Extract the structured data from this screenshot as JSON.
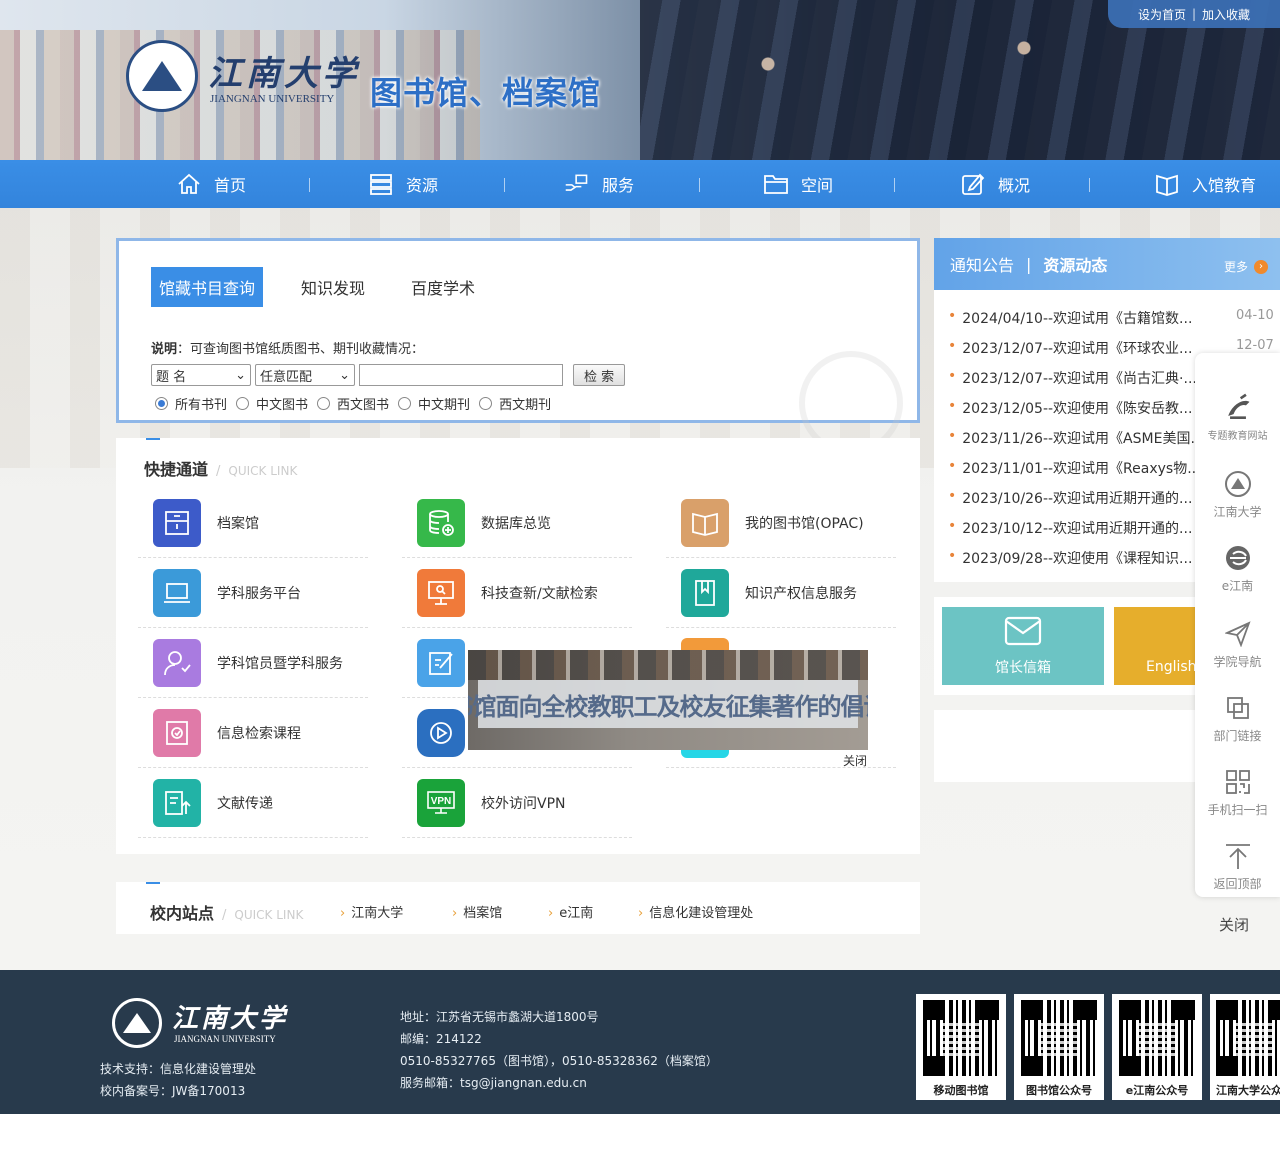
{
  "header": {
    "logo_cn": "江南大学",
    "logo_en": "JIANGNAN UNIVERSITY",
    "site_title": "图书馆、档案馆",
    "top_links": [
      "设为首页",
      "加入收藏"
    ]
  },
  "nav": [
    {
      "label": "首页",
      "icon": "home-icon"
    },
    {
      "label": "资源",
      "icon": "database-icon"
    },
    {
      "label": "服务",
      "icon": "hand-service-icon"
    },
    {
      "label": "空间",
      "icon": "folder-icon"
    },
    {
      "label": "概况",
      "icon": "edit-icon"
    },
    {
      "label": "入馆教育",
      "icon": "book-open-icon"
    }
  ],
  "search": {
    "tabs": [
      "馆藏书目查询",
      "知识发现",
      "百度学术"
    ],
    "desc_bold": "说明",
    "desc_text": "：可查询图书馆纸质图书、期刊收藏情况：",
    "field_select": "题 名",
    "match_select": "任意匹配",
    "input_value": "",
    "button": "检 索",
    "radios": [
      "所有书刊",
      "中文图书",
      "西文图书",
      "中文期刊",
      "西文期刊"
    ],
    "radio_selected": 0
  },
  "quick": {
    "title": "快捷通道",
    "title_en": "QUICK LINK",
    "items": [
      {
        "label": "档案馆",
        "icon": "archive-icon",
        "color": "#3d5bc9"
      },
      {
        "label": "数据库总览",
        "icon": "database-add-icon",
        "color": "#36b84a"
      },
      {
        "label": "我的图书馆(OPAC)",
        "icon": "open-book-icon",
        "color": "#d9a06a"
      },
      {
        "label": "学科服务平台",
        "icon": "laptop-icon",
        "color": "#3b9ad9"
      },
      {
        "label": "科技查新/文献检索",
        "icon": "monitor-search-icon",
        "color": "#f07a3a"
      },
      {
        "label": "知识产权信息服务",
        "icon": "bookmark-book-icon",
        "color": "#1fa89a"
      },
      {
        "label": "学科馆员暨学科服务",
        "icon": "user-icon",
        "color": "#a97be0"
      },
      {
        "label": "",
        "icon": "edit-doc-icon",
        "color": "#4aa3e8"
      },
      {
        "label": "信息检索课程",
        "icon": "search-doc-icon",
        "color": "#e07aa8"
      },
      {
        "label": "",
        "icon": "play-icon",
        "color": "#2b6fc0"
      },
      {
        "label": "文献传递",
        "icon": "doc-upload-icon",
        "color": "#22b3a6"
      },
      {
        "label": "校外访问VPN",
        "icon": "vpn-icon",
        "color": "#1aa33a"
      }
    ]
  },
  "popup": {
    "text": "图书馆面向全校教职工及校友征集著作的倡议书",
    "close": "关闭"
  },
  "sites": {
    "title": "校内站点",
    "title_en": "QUICK LINK",
    "links": [
      "江南大学",
      "档案馆",
      "e江南",
      "信息化建设管理处"
    ]
  },
  "notice": {
    "tab1": "通知公告",
    "tab2": "资源动态",
    "more": "更多",
    "items": [
      {
        "title": "2024/04/10--欢迎试用《古籍馆数...",
        "date": "04-10"
      },
      {
        "title": "2023/12/07--欢迎试用《环球农业...",
        "date": "12-07"
      },
      {
        "title": "2023/12/07--欢迎试用《尚古汇典·...",
        "date": ""
      },
      {
        "title": "2023/12/05--欢迎使用《陈安岳教...",
        "date": ""
      },
      {
        "title": "2023/11/26--欢迎试用《ASME美国...",
        "date": ""
      },
      {
        "title": "2023/11/01--欢迎试用《Reaxys物...",
        "date": ""
      },
      {
        "title": "2023/10/26--欢迎试用近期开通的...",
        "date": ""
      },
      {
        "title": "2023/10/12--欢迎试用近期开通的...",
        "date": ""
      },
      {
        "title": "2023/09/28--欢迎使用《课程知识...",
        "date": ""
      }
    ]
  },
  "cards": [
    {
      "label": "馆长信箱",
      "icon": "mail-icon",
      "color": "#6cc4c4"
    },
    {
      "label": "English",
      "icon": "globe-icon",
      "color": "#e6ae2c"
    }
  ],
  "float_bar": {
    "items": [
      {
        "label": "专题教育网站",
        "icon": "party-emblem-icon"
      },
      {
        "label": "江南大学",
        "icon": "university-seal-icon"
      },
      {
        "label": "e江南",
        "icon": "e-logo-icon"
      },
      {
        "label": "学院导航",
        "icon": "send-icon"
      },
      {
        "label": "部门链接",
        "icon": "copy-link-icon"
      },
      {
        "label": "手机扫一扫",
        "icon": "qrcode-icon"
      },
      {
        "label": "返回顶部",
        "icon": "back-top-icon"
      }
    ],
    "close": "关闭"
  },
  "footer": {
    "logo_cn": "江南大学",
    "logo_en": "JIANGNAN UNIVERSITY",
    "support": "技术支持：信息化建设管理处",
    "icp": "校内备案号：JW备170013",
    "address": "地址：江苏省无锡市蠡湖大道1800号",
    "postcode": "邮编：214122",
    "phone": "0510-85327765（图书馆），0510-85328362（档案馆）",
    "email": "服务邮箱：tsg@jiangnan.edu.cn",
    "qrcodes": [
      "移动图书馆",
      "图书馆公众号",
      "e江南公众号",
      "江南大学公众号"
    ]
  }
}
